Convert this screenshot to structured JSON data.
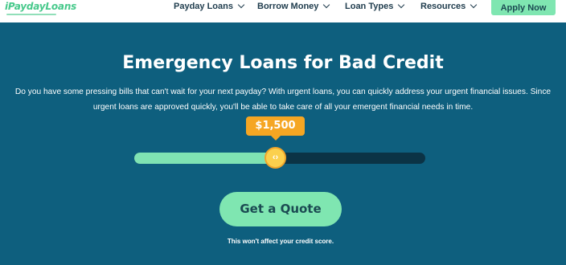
{
  "header": {
    "logo_text": "iPaydayLoans",
    "nav": [
      {
        "label": "Payday Loans"
      },
      {
        "label": "Borrow Money"
      },
      {
        "label": "Loan Types"
      },
      {
        "label": "Resources"
      }
    ],
    "apply_label": "Apply Now"
  },
  "hero": {
    "title": "Emergency Loans for Bad Credit",
    "description": "Do you have some pressing bills that can't wait for your next payday? With urgent loans, you can quickly address your urgent financial issues. Since urgent loans are approved quickly, you'll be able to take care of all your emergent financial needs in time."
  },
  "slider": {
    "amount": "$1,500",
    "thumb_glyph": "‹›",
    "fill_fraction": 0.48
  },
  "cta": {
    "button_label": "Get a Quote",
    "note": "This won't affect your credit score."
  },
  "colors": {
    "background": "#0e5f7e",
    "accent_green": "#7fe6b1",
    "badge_orange": "#f5a623",
    "thumb_yellow": "#fbd04d"
  }
}
